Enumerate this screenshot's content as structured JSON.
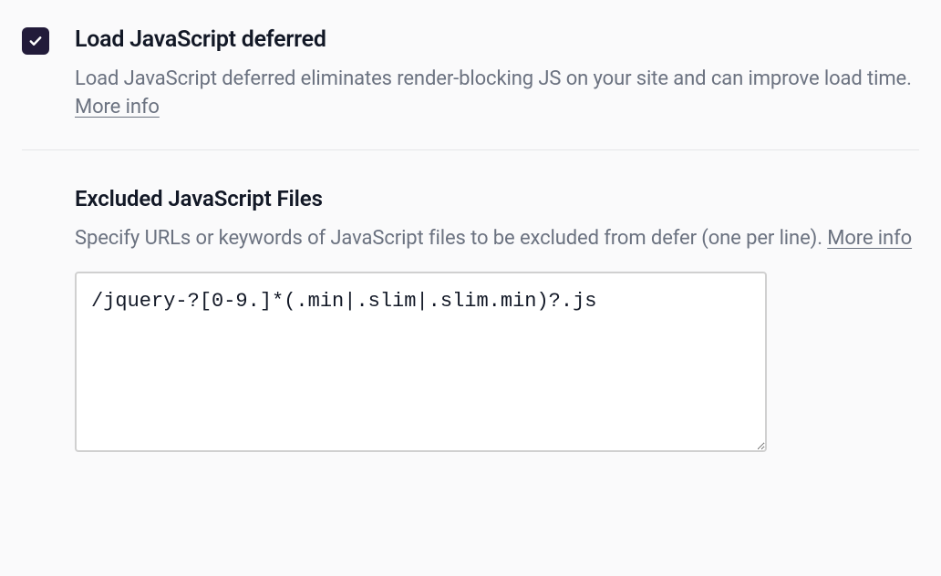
{
  "defer": {
    "title": "Load JavaScript deferred",
    "description_before": "Load JavaScript deferred eliminates render-blocking JS on your site and can improve load time. ",
    "more_info": "More info",
    "checked": true
  },
  "excluded": {
    "title": "Excluded JavaScript Files",
    "description_before": "Specify URLs or keywords of JavaScript files to be excluded from defer (one per line). ",
    "more_info": "More info",
    "value": "/jquery-?[0-9.]*(.min|.slim|.slim.min)?.js"
  }
}
